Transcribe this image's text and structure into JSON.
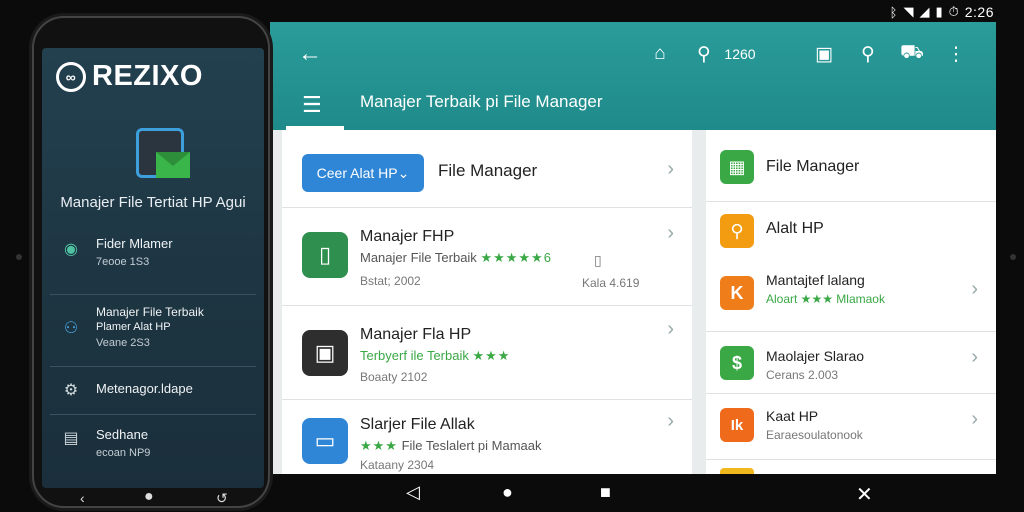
{
  "status": {
    "time": "2:26"
  },
  "phone": {
    "brand": "REZIXO",
    "hero_title": "Manajer File Tertiat HP Agui",
    "items": [
      {
        "label": "Fider Mlamer",
        "sub": "7eooe 1S3"
      },
      {
        "label": "Manajer File Terbaik",
        "label2": "Plamer Alat HP",
        "sub": "Veane 2S3"
      },
      {
        "label": "Metenagor.ldape",
        "sub": ""
      },
      {
        "label": "Sedhane",
        "sub": "ecoan NP9"
      }
    ]
  },
  "appbar": {
    "title": "Manajer Terbaik pi File Manager",
    "search_count": "1260"
  },
  "left_list": {
    "header": {
      "pill_label": "Ceer Alat HP ",
      "title": "File Manager"
    },
    "rows": [
      {
        "title": "Manajer FHP",
        "sub": "Manajer File Terbaik",
        "stars": "★★★★★6",
        "meta": "Bstat; 2002",
        "meta_right": "Kala 4.619",
        "right_icon": "▯"
      },
      {
        "title": "Manajer Fla HP",
        "sub": "Terbyerf ile Terbaik",
        "stars": "★★★",
        "meta": "Boaaty 2102"
      },
      {
        "title": "Slarjer File Allak",
        "sub": "File Teslalert pi Mamaak",
        "stars": "★★★",
        "meta": "Kataany 2304"
      }
    ]
  },
  "right_list": {
    "rows": [
      {
        "title": "File Manager",
        "sub": ""
      },
      {
        "title": "Alalt HP",
        "sub": ""
      },
      {
        "title": "Mantajtef lalang",
        "sub": "Aloart ★★★ Mlamaok"
      },
      {
        "title": "Maolajer Slarao",
        "sub": "Cerans 2.003"
      },
      {
        "title": "Kaat HP",
        "sub": "Earaesoulatonook"
      }
    ]
  },
  "colors": {
    "teal": "#1f8a8a",
    "blue": "#2f86d6",
    "green": "#3aa845",
    "orange": "#f08a1c",
    "phone_bg": "#1d3441"
  }
}
